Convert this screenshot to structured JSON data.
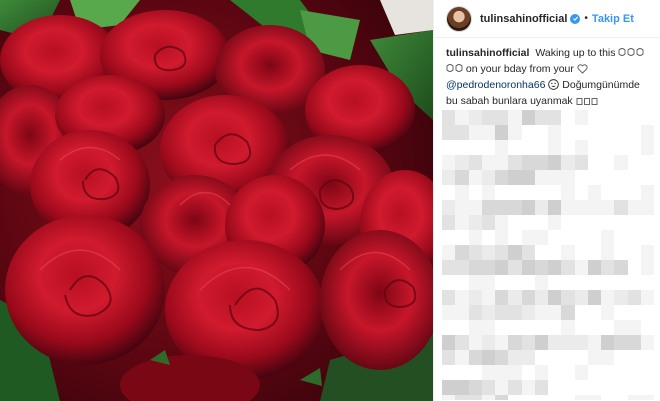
{
  "post": {
    "image_alt_icon": "red-roses-bouquet",
    "header": {
      "username": "tulinsahinofficial",
      "verified_icon": "verified-badge-icon",
      "separator": "•",
      "follow_label": "Takip Et"
    },
    "caption": {
      "username": "tulinsahinofficial",
      "line1": "Waking up to this",
      "line2": "on your bday from your",
      "mention": "@pedrodenoronha66",
      "line3": "Doğumgünümde",
      "line4": "bu sabah bunlara uyanmak"
    },
    "colors": {
      "accent": "#3897f0",
      "text": "#262626",
      "mention": "#003569",
      "rose_dark": "#5a0611",
      "rose_light": "#c8162c"
    }
  }
}
